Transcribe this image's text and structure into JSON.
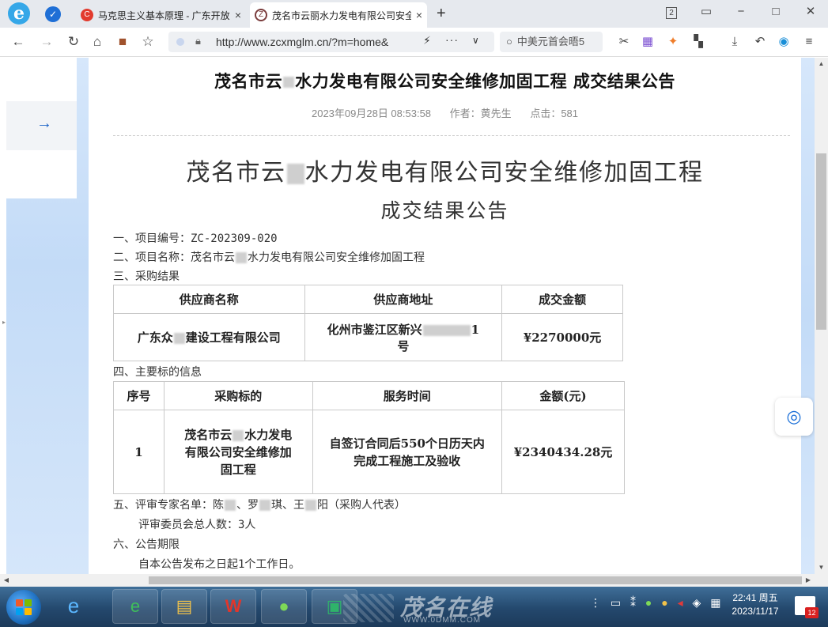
{
  "browser": {
    "tabs": [
      {
        "title": "马克思主义基本原理 - 广东开放",
        "close": "×",
        "favicon": "red-c-icon"
      },
      {
        "title": "茂名市云丽水力发电有限公司安全",
        "close": "×",
        "favicon": "site-logo-icon"
      }
    ],
    "new_tab": "+",
    "address": "http://www.zcxmglm.cn/?m=home&",
    "search_text": "中美元首会晤5",
    "window_controls": [
      "2",
      "▭",
      "−",
      "□",
      "✕"
    ]
  },
  "article": {
    "header_title_a": "茂名市云",
    "header_title_b": "水力发电有限公司安全维修加固工程 成交结果公告",
    "date": "2023年09月28日 08:53:58",
    "author": "作者：黄先生",
    "clicks": "点击：581",
    "big_title_a": "茂名市云",
    "big_title_b": "水力发电有限公司安全维修加固工程",
    "big_subtitle": "成交结果公告",
    "item1": "一、项目编号：ZC-202309-020",
    "item2_a": "二、项目名称：茂名市云",
    "item2_b": "水力发电有限公司安全维修加固工程",
    "item3": "三、采购结果",
    "table1": {
      "headers": [
        "供应商名称",
        "供应商地址",
        "成交金额"
      ],
      "row": {
        "name_a": "广东众",
        "name_b": "建设工程有限公司",
        "addr_a": "化州市鉴江区新兴",
        "addr_b": "1",
        "addr_c": "号",
        "amount": "¥2270000元"
      }
    },
    "item4": "四、主要标的信息",
    "table2": {
      "headers": [
        "序号",
        "采购标的",
        "服务时间",
        "金额(元)"
      ],
      "row": {
        "no": "1",
        "target_a": "茂名市云",
        "target_b": "水力发电",
        "target_c": "有限公司安全维修加",
        "target_d": "固工程",
        "service_a": "自签订合同后550个日历天内",
        "service_b": "完成工程施工及验收",
        "amount": "¥2340434.28元"
      }
    },
    "item5_a": "五、评审专家名单：陈",
    "item5_b": "、罗",
    "item5_c": "琪、王",
    "item5_d": "阳（采购人代表）",
    "item5_sub": "评审委员会总人数：3人",
    "item6": "六、公告期限",
    "item6_sub": "自本公告发布之日起1个工作日。"
  },
  "taskbar": {
    "watermark": "茂名在线",
    "watermark_url": "WWW.0DMM.COM",
    "time": "22:41 周五",
    "date": "2023/11/17",
    "notify_count": "12"
  }
}
